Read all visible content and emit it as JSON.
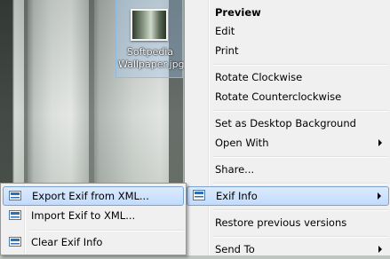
{
  "desktop": {
    "file": {
      "label_line1": "Softpedia",
      "label_line2": "Wallpaper.jpg"
    }
  },
  "context_menu": {
    "items": [
      {
        "label": "Preview"
      },
      {
        "label": "Edit"
      },
      {
        "label": "Print"
      },
      {
        "label": "Rotate Clockwise"
      },
      {
        "label": "Rotate Counterclockwise"
      },
      {
        "label": "Set as Desktop Background"
      },
      {
        "label": "Open With"
      },
      {
        "label": "Share..."
      },
      {
        "label": "Exif Info"
      },
      {
        "label": "Restore previous versions"
      },
      {
        "label": "Send To"
      }
    ]
  },
  "submenu": {
    "items": [
      {
        "label": "Export Exif from XML...",
        "icon": "exif-icon"
      },
      {
        "label": "Import Exif to XML...",
        "icon": "exif-icon"
      },
      {
        "label": "Clear Exif Info",
        "icon": "exif-icon"
      }
    ]
  },
  "colors": {
    "menu_bg": "#f0f0f0",
    "highlight_border": "#7da2ce",
    "highlight_fill": "#c1dbfc",
    "icon_accent": "#2f6fb3"
  }
}
